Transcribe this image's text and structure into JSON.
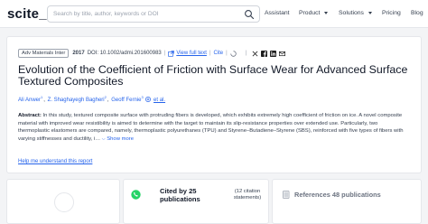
{
  "header": {
    "logo": "scite_",
    "search_placeholder": "Search by title, author, keywords or DOI",
    "nav": {
      "assistant": "Assistant",
      "product": "Product",
      "solutions": "Solutions",
      "pricing": "Pricing",
      "blog": "Blog"
    }
  },
  "article": {
    "journal": "Adv Materials Inter",
    "year": "2017",
    "doi": "DOI: 10.1002/admi.201600983",
    "view_full_text": "View full text",
    "cite": "Cite",
    "title": "Evolution of the Coefficient of Friction with Surface Wear for Advanced Surface Textured Composites",
    "authors": [
      {
        "name": "Ali Anwer",
        "sup": "1"
      },
      {
        "name": "Z. Shaghayegh Bagheri",
        "sup": "2"
      },
      {
        "name": "Geoff Fernie",
        "sup": "3"
      }
    ],
    "et_al": "et al.",
    "abstract_label": "Abstract:",
    "abstract_text": "In this study, textured composite surface with protruding fibers is developed, which exhibits extremely high coefficient of friction on ice. A novel composite material with improved wear resistibility is aimed to determine with the target to maintain its slip-resistance properties over extended use. Particularly, two thermoplastic elastomers are compared, namely, thermoplastic polyurethanes (TPU) and Styrene–Butadiene–Styrene (SBS), reinforced with five types of fibers with varying stiffnesses and ductility, i…",
    "show_more": "Show more",
    "help_link": "Help me understand this report"
  },
  "stats": {
    "cited_by": "Cited by 25 publications",
    "citation_statements": "(12 citation statements)",
    "references": "References 48 publications"
  },
  "colors": {
    "link": "#2563eb",
    "whatsapp": "#25d366",
    "twitter": "#1d1d1d"
  }
}
